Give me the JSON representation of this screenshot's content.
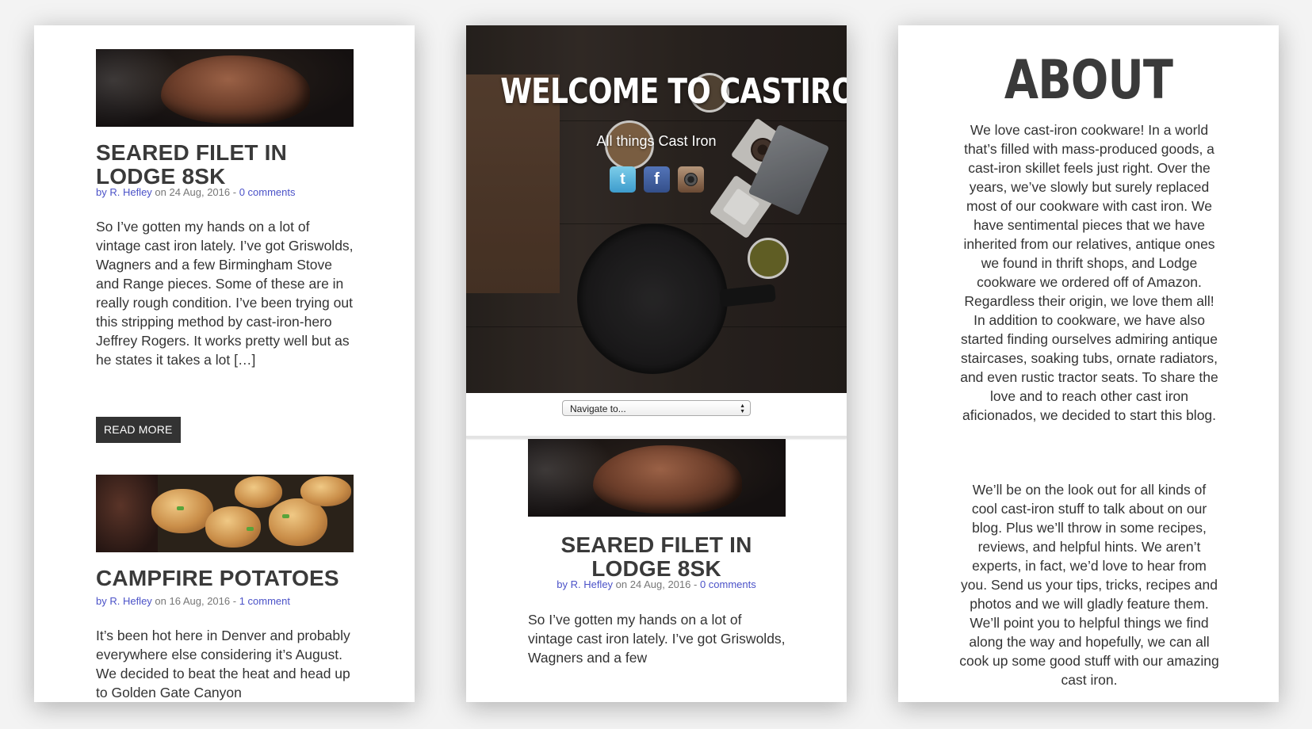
{
  "left_panel": {
    "post1": {
      "title": "SEARED FILET IN LODGE 8SK",
      "meta_by": "by R. Hefley",
      "meta_date": " on 24 Aug, 2016 - ",
      "meta_comments": "0 comments",
      "excerpt": "So I’ve gotten my hands on a lot of vintage cast iron lately. I’ve got Griswolds, Wagners and a few Birmingham Stove and Range pieces. Some of these are in really rough condition. I’ve been trying out this stripping method  by cast-iron-hero Jeffrey Rogers. It works pretty well but as he states it takes a lot […]",
      "read_more": "READ MORE"
    },
    "post2": {
      "title": "CAMPFIRE POTATOES",
      "meta_by": "by R. Hefley",
      "meta_date": " on 16 Aug, 2016 - ",
      "meta_comments": "1 comment",
      "excerpt": "It’s been hot here in Denver and probably everywhere else considering it’s August. We decided to beat the heat and head up to Golden Gate Canyon"
    }
  },
  "middle_panel": {
    "hero_title": "WELCOME TO CASTIRONED",
    "hero_subtitle": "All things Cast Iron",
    "social": [
      "twitter-icon",
      "facebook-icon",
      "instagram-icon"
    ],
    "nav_select": "Navigate to...",
    "post": {
      "title": "SEARED FILET IN LODGE 8SK",
      "meta_by": "by R. Hefley",
      "meta_date": " on 24 Aug, 2016 - ",
      "meta_comments": "0 comments",
      "excerpt": "So I’ve gotten my hands on a lot of vintage cast iron lately. I’ve got Griswolds, Wagners and a few"
    }
  },
  "right_panel": {
    "title": "ABOUT",
    "paragraph1": "We love cast-iron cookware! In a world that’s filled with mass-produced goods, a cast-iron skillet feels just right. Over the years, we’ve slowly but surely replaced most of our cookware with cast iron. We have sentimental pieces that we have inherited from our relatives, antique ones we found in thrift shops, and Lodge cookware we ordered off of Amazon. Regardless their origin, we love them all! In addition to cookware, we have also started finding ourselves admiring antique staircases, soaking tubs, ornate radiators, and even rustic tractor seats. To share the love and to reach other cast iron aficionados, we decided to start this blog.",
    "paragraph2": "We’ll be on the look out for all kinds of cool cast-iron stuff to talk about on our blog. Plus we’ll throw in some recipes, reviews, and helpful hints. We aren’t experts, in fact, we’d love to hear from you. Send us your tips, tricks, recipes and photos and we will gladly feature them. We’ll point you to helpful things we find along the way and hopefully, we can all cook up some good stuff with our amazing cast iron."
  },
  "colors": {
    "link": "#4b52c8",
    "button_bg": "#333333",
    "background": "#f3f3f3"
  }
}
